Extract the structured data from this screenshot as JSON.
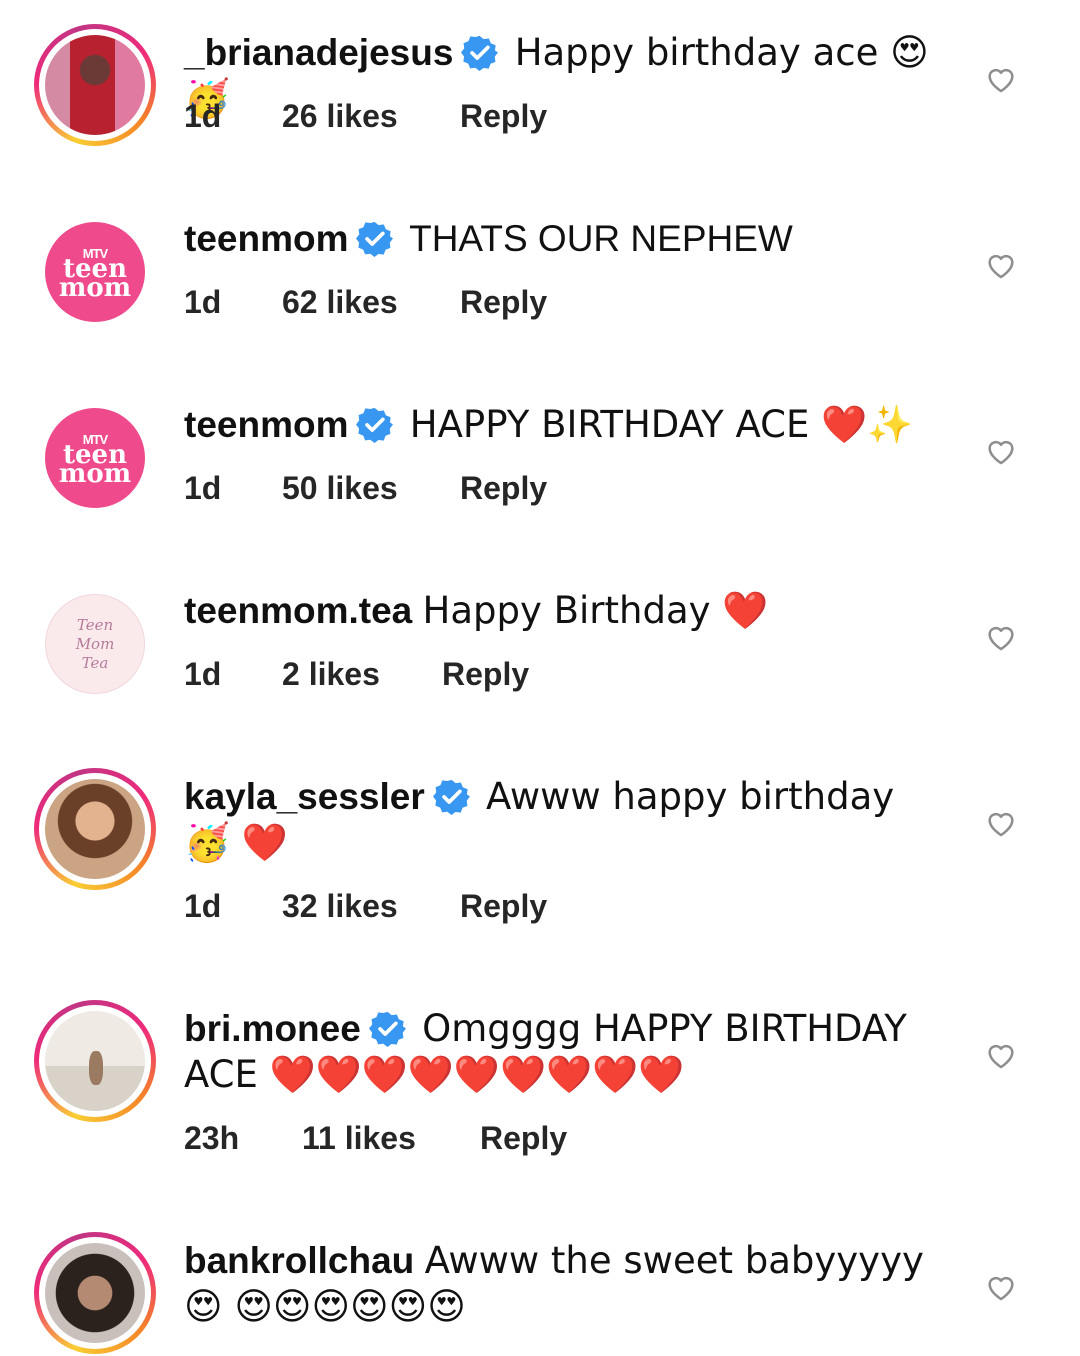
{
  "comments": [
    {
      "username": "_brianadejesus",
      "verified": true,
      "text": "Happy birthday ace 😍🥳",
      "time": "1d",
      "likes": "26 likes",
      "reply": "Reply"
    },
    {
      "username": "teenmom",
      "verified": true,
      "text": "THATS OUR NEPHEW",
      "time": "1d",
      "likes": "62 likes",
      "reply": "Reply",
      "avatar_text": [
        "MTV",
        "teen",
        "mom"
      ]
    },
    {
      "username": "teenmom",
      "verified": true,
      "text": "HAPPY BIRTHDAY ACE ❤️✨",
      "time": "1d",
      "likes": "50 likes",
      "reply": "Reply",
      "avatar_text": [
        "MTV",
        "teen",
        "mom"
      ]
    },
    {
      "username": "teenmom.tea",
      "verified": false,
      "text": "Happy Birthday ❤️",
      "time": "1d",
      "likes": "2 likes",
      "reply": "Reply",
      "avatar_text": [
        "Teen",
        "Mom",
        "Tea"
      ]
    },
    {
      "username": "kayla_sessler",
      "verified": true,
      "text": "Awww happy birthday 🥳 ❤️",
      "time": "1d",
      "likes": "32 likes",
      "reply": "Reply"
    },
    {
      "username": "bri.monee",
      "verified": true,
      "text": "Omgggg HAPPY BIRTHDAY ACE ❤️❤️❤️❤️❤️❤️❤️❤️❤️",
      "time": "23h",
      "likes": "11 likes",
      "reply": "Reply"
    },
    {
      "username": "bankrollchau",
      "verified": false,
      "text": "Awww the sweet babyyyyy😍 😍😍😍😍😍😍",
      "time": "",
      "likes": "",
      "reply": ""
    }
  ],
  "icons": {
    "verified": "verified-badge-icon",
    "like": "heart-outline-icon"
  },
  "colors": {
    "verified": "#3897f0",
    "teen_mom_pink": "#ef4b8c"
  }
}
